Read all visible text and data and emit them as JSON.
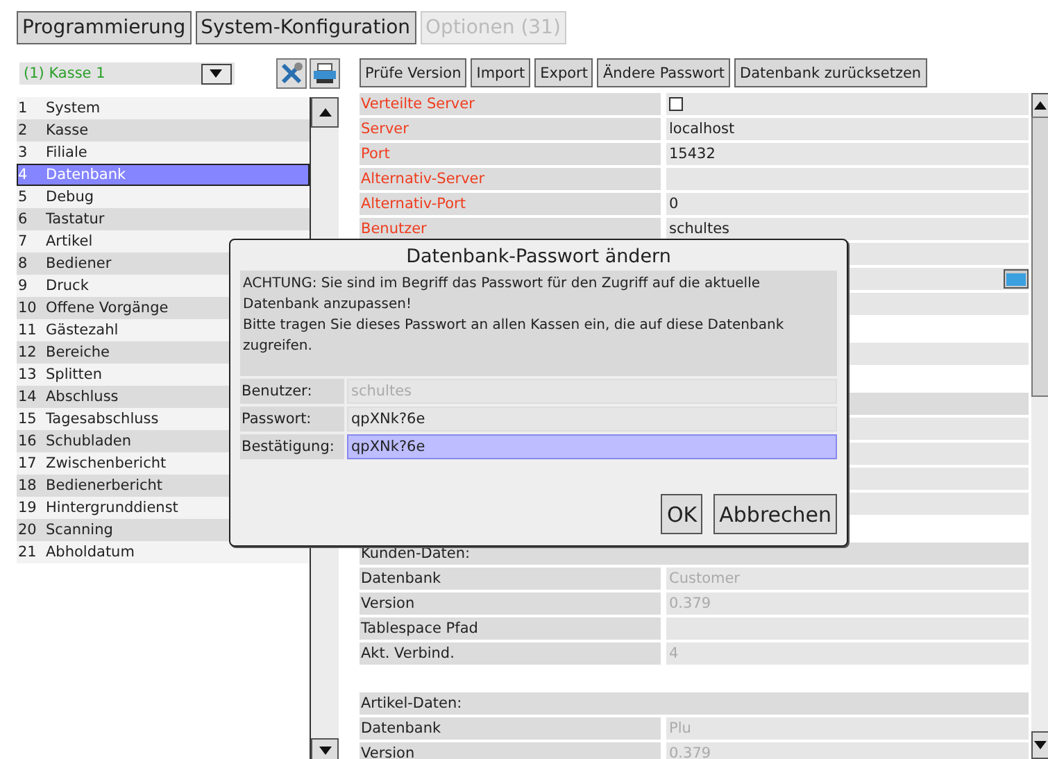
{
  "tabs": [
    {
      "label": "Programmierung",
      "disabled": false
    },
    {
      "label": "System-Konfiguration",
      "disabled": false
    },
    {
      "label": "Optionen (31)",
      "disabled": true
    }
  ],
  "register_select": {
    "value": "(1) Kasse 1"
  },
  "nav_items": [
    {
      "number": "1",
      "label": "System",
      "selected": false
    },
    {
      "number": "2",
      "label": "Kasse",
      "selected": false
    },
    {
      "number": "3",
      "label": "Filiale",
      "selected": false
    },
    {
      "number": "4",
      "label": "Datenbank",
      "selected": true
    },
    {
      "number": "5",
      "label": "Debug",
      "selected": false
    },
    {
      "number": "6",
      "label": "Tastatur",
      "selected": false
    },
    {
      "number": "7",
      "label": "Artikel",
      "selected": false
    },
    {
      "number": "8",
      "label": "Bediener",
      "selected": false
    },
    {
      "number": "9",
      "label": "Druck",
      "selected": false
    },
    {
      "number": "10",
      "label": "Offene Vorgänge",
      "selected": false
    },
    {
      "number": "11",
      "label": "Gästezahl",
      "selected": false
    },
    {
      "number": "12",
      "label": "Bereiche",
      "selected": false
    },
    {
      "number": "13",
      "label": "Splitten",
      "selected": false
    },
    {
      "number": "14",
      "label": "Abschluss",
      "selected": false
    },
    {
      "number": "15",
      "label": "Tagesabschluss",
      "selected": false
    },
    {
      "number": "16",
      "label": "Schubladen",
      "selected": false
    },
    {
      "number": "17",
      "label": "Zwischenbericht",
      "selected": false
    },
    {
      "number": "18",
      "label": "Bedienerbericht",
      "selected": false
    },
    {
      "number": "19",
      "label": "Hintergrunddienst",
      "selected": false
    },
    {
      "number": "20",
      "label": "Scanning",
      "selected": false
    },
    {
      "number": "21",
      "label": "Abholdatum",
      "selected": false
    }
  ],
  "toolbar_buttons": [
    "Prüfe Version",
    "Import",
    "Export",
    "Ändere Passwort",
    "Datenbank zurücksetzen"
  ],
  "settings_rows": [
    {
      "kind": "checkbox",
      "label": "Verteilte Server",
      "required": true,
      "checked": false
    },
    {
      "kind": "field",
      "label": "Server",
      "required": true,
      "value": "localhost",
      "disabled": false
    },
    {
      "kind": "field",
      "label": "Port",
      "required": true,
      "value": "15432",
      "disabled": false
    },
    {
      "kind": "field",
      "label": "Alternativ-Server",
      "required": true
    },
    {
      "kind": "field",
      "label": "Alternativ-Port",
      "required": true,
      "value": "0",
      "disabled": false
    },
    {
      "kind": "field",
      "label": "Benutzer",
      "required": true,
      "value": "schultes",
      "disabled": false
    },
    {
      "kind": "field"
    },
    {
      "kind": "field",
      "browse": true
    },
    {
      "kind": "field"
    },
    {
      "kind": "spacer"
    },
    {
      "kind": "field"
    },
    {
      "kind": "spacer"
    },
    {
      "kind": "header"
    },
    {
      "kind": "field"
    },
    {
      "kind": "field"
    },
    {
      "kind": "field"
    },
    {
      "kind": "field"
    },
    {
      "kind": "spacer"
    },
    {
      "kind": "header",
      "label": "Kunden-Daten:"
    },
    {
      "kind": "field",
      "label": "Datenbank",
      "value": "Customer",
      "disabled": true
    },
    {
      "kind": "field",
      "label": "Version",
      "value": "0.379",
      "disabled": true
    },
    {
      "kind": "field",
      "label": "Tablespace Pfad"
    },
    {
      "kind": "field",
      "label": "Akt. Verbind.",
      "value": "4",
      "disabled": true
    },
    {
      "kind": "spacer"
    },
    {
      "kind": "header",
      "label": "Artikel-Daten:"
    },
    {
      "kind": "field",
      "label": "Datenbank",
      "value": "Plu",
      "disabled": true
    },
    {
      "kind": "field",
      "label": "Version",
      "value": "0.379",
      "disabled": true
    }
  ],
  "dialog": {
    "title": "Datenbank-Passwort ändern",
    "message": [
      "ACHTUNG: Sie sind im Begriff das Passwort für den Zugriff auf die aktuelle Datenbank anzupassen!",
      "Bitte tragen Sie dieses Passwort an allen Kassen ein, die auf diese Datenbank zugreifen."
    ],
    "fields": [
      {
        "label": "Benutzer:",
        "value": "schultes",
        "disabled": true,
        "selected": false
      },
      {
        "label": "Passwort:",
        "value": "qpXNk?6e",
        "disabled": false,
        "selected": false
      },
      {
        "label": "Bestätigung:",
        "value": "qpXNk?6e",
        "disabled": false,
        "selected": true
      }
    ],
    "buttons": [
      "OK",
      "Abbrechen"
    ]
  }
}
